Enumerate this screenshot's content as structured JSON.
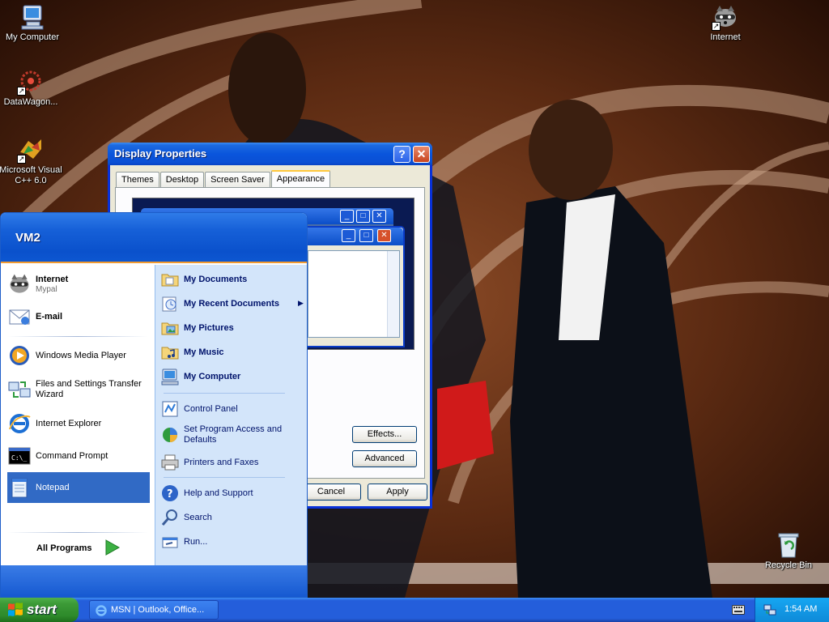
{
  "desktop": {
    "icons": [
      {
        "label": "My Computer"
      },
      {
        "label": "DataWagon..."
      },
      {
        "label": "Microsoft Visual C++ 6.0"
      },
      {
        "label": "Internet"
      },
      {
        "label": "Recycle Bin"
      }
    ]
  },
  "display_properties": {
    "title": "Display Properties",
    "tabs": [
      {
        "label": "Themes"
      },
      {
        "label": "Desktop"
      },
      {
        "label": "Screen Saver"
      },
      {
        "label": "Appearance"
      }
    ],
    "active_tab": "Appearance",
    "buttons": {
      "effects": "Effects...",
      "advanced": "Advanced",
      "cancel": "Cancel",
      "apply": "Apply"
    }
  },
  "start_menu": {
    "user_name": "VM2",
    "pinned": [
      {
        "label": "Internet",
        "sub": "Mypal"
      },
      {
        "label": "E-mail",
        "sub": ""
      }
    ],
    "recent": [
      {
        "label": "Windows Media Player"
      },
      {
        "label": "Files and Settings Transfer Wizard"
      },
      {
        "label": "Internet Explorer"
      },
      {
        "label": "Command Prompt"
      },
      {
        "label": "Notepad"
      }
    ],
    "selected": "Notepad",
    "all_programs": "All Programs",
    "places": [
      {
        "label": "My Documents"
      },
      {
        "label": "My Recent Documents"
      },
      {
        "label": "My Pictures"
      },
      {
        "label": "My Music"
      },
      {
        "label": "My Computer"
      }
    ],
    "settings": [
      {
        "label": "Control Panel"
      },
      {
        "label": "Set Program Access and Defaults"
      },
      {
        "label": "Printers and Faxes"
      }
    ],
    "tools": [
      {
        "label": "Help and Support"
      },
      {
        "label": "Search"
      },
      {
        "label": "Run..."
      }
    ]
  },
  "taskbar": {
    "start_label": "start",
    "tasks": [
      {
        "label": "MSN | Outlook, Office..."
      }
    ],
    "clock": "1:54 AM"
  },
  "colors": {
    "taskbar_blue": "#245edb",
    "start_green": "#3c9a37",
    "start_menu_header": "#1660d8",
    "selection": "#316ac5",
    "window_face": "#ece9d8"
  }
}
